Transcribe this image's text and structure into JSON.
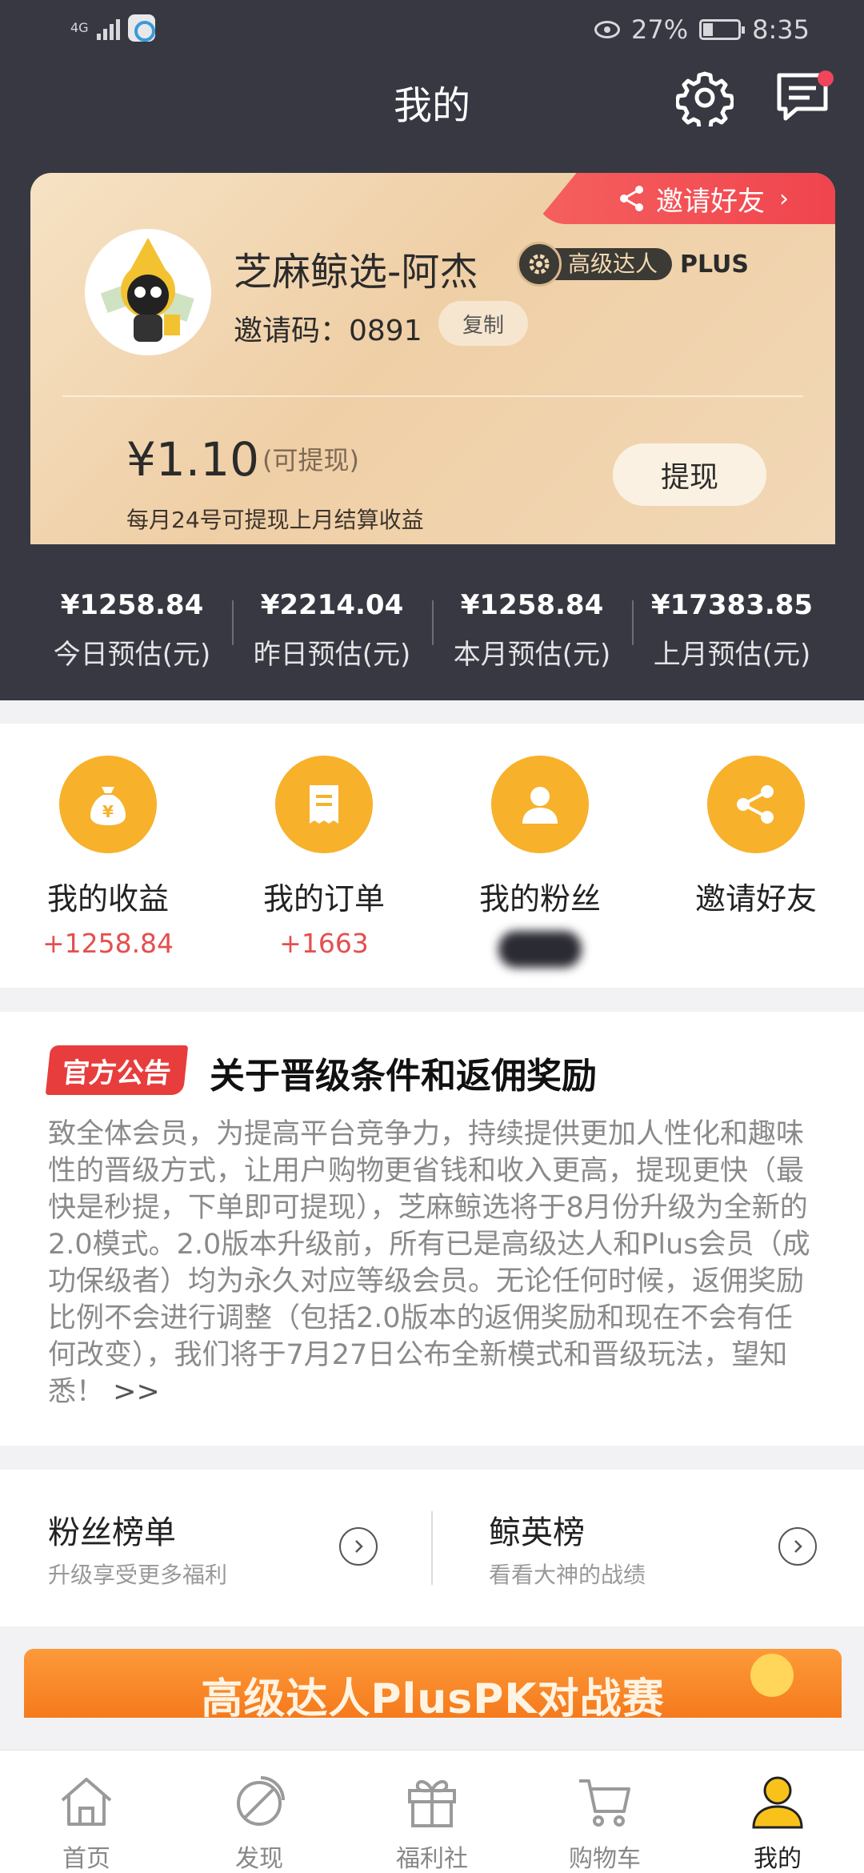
{
  "status_bar": {
    "network": "4G",
    "battery": "27%",
    "time": "8:35"
  },
  "header": {
    "title": "我的"
  },
  "profile": {
    "invite_tag": "邀请好友",
    "name": "芝麻鲸选-阿杰",
    "level": "高级达人",
    "plus": "PLUS",
    "invite_code": "邀请码：0891",
    "copy_label": "复制",
    "balance": "¥1.10",
    "balance_note": "(可提现)",
    "balance_hint": "每月24号可提现上月结算收益",
    "withdraw_label": "提现"
  },
  "stats": [
    {
      "value": "¥1258.84",
      "label": "今日预估(元)"
    },
    {
      "value": "¥2214.04",
      "label": "昨日预估(元)"
    },
    {
      "value": "¥1258.84",
      "label": "本月预估(元)"
    },
    {
      "value": "¥17383.85",
      "label": "上月预估(元)"
    }
  ],
  "shortcuts": [
    {
      "label": "我的收益",
      "sub": "+1258.84",
      "icon": "money-bag-icon"
    },
    {
      "label": "我的订单",
      "sub": "+1663",
      "icon": "receipt-icon"
    },
    {
      "label": "我的粉丝",
      "sub": "",
      "icon": "person-icon"
    },
    {
      "label": "邀请好友",
      "sub": "",
      "icon": "share-icon"
    }
  ],
  "notice": {
    "tag": "官方公告",
    "title": "关于晋级条件和返佣奖励",
    "body": "致全体会员，为提高平台竞争力，持续提供更加人性化和趣味性的晋级方式，让用户购物更省钱和收入更高，提现更快（最快是秒提，下单即可提现），芝麻鲸选将于8月份升级为全新的2.0模式。2.0版本升级前，所有已是高级达人和Plus会员（成功保级者）均为永久对应等级会员。无论任何时候，返佣奖励比例不会进行调整（包括2.0版本的返佣奖励和现在不会有任何改变），我们将于7月27日公布全新模式和晋级玩法，望知悉！",
    "more": ">>"
  },
  "ranks": [
    {
      "title": "粉丝榜单",
      "sub": "升级享受更多福利"
    },
    {
      "title": "鲸英榜",
      "sub": "看看大神的战绩"
    }
  ],
  "banner": {
    "text": "高级达人PlusPK对战赛"
  },
  "tabbar": [
    {
      "label": "首页",
      "icon": "home-icon"
    },
    {
      "label": "发现",
      "icon": "compass-icon"
    },
    {
      "label": "福利社",
      "icon": "gift-icon"
    },
    {
      "label": "购物车",
      "icon": "cart-icon"
    },
    {
      "label": "我的",
      "icon": "profile-icon"
    }
  ],
  "colors": {
    "header_bg": "#373841",
    "accent_orange": "#f7b12b",
    "notice_red": "#e83d3d",
    "highlight_red": "#e44f4f"
  }
}
